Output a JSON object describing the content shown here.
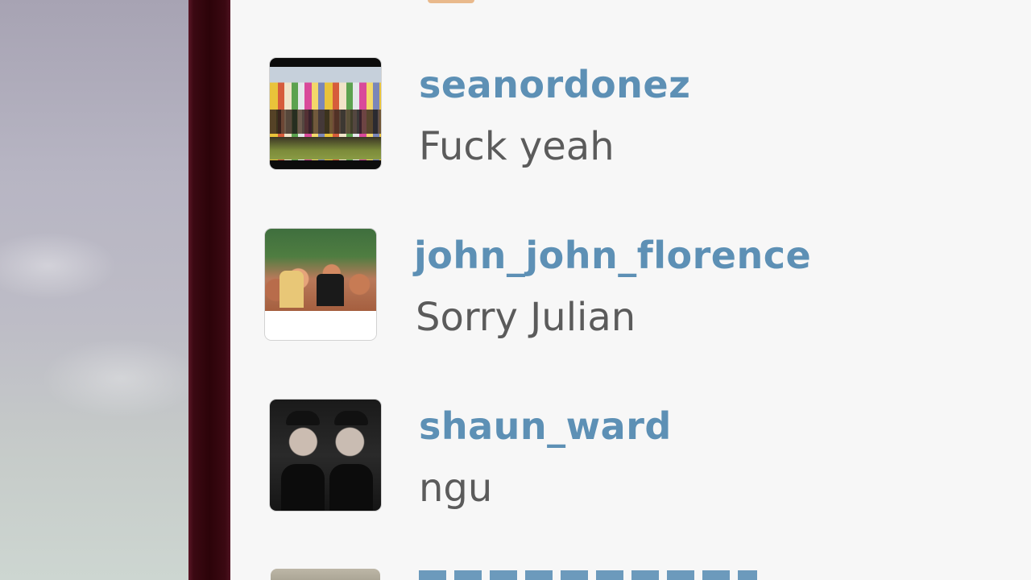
{
  "comments": [
    {
      "username": "seanordonez",
      "message": "Fuck yeah",
      "avatar_icon": "group-surfboards-photo"
    },
    {
      "username": "john_john_florence",
      "message": "Sorry Julian",
      "avatar_icon": "group-photo"
    },
    {
      "username": "shaun_ward",
      "message": "ngu",
      "avatar_icon": "two-people-photo"
    }
  ],
  "colors": {
    "username": "#5d90b5",
    "message": "#5b5b5b",
    "panel_background": "#f7f7f7",
    "divider": "#2c0309"
  }
}
